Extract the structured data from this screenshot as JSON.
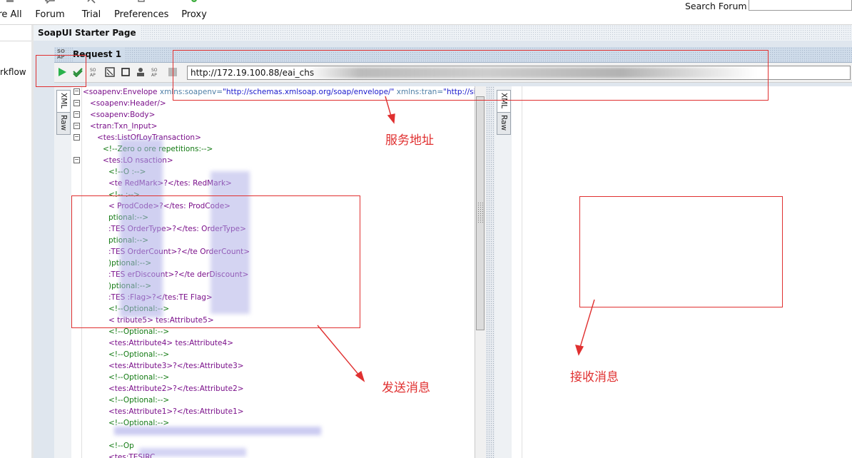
{
  "toolbar": {
    "items": [
      {
        "label": "re All",
        "icon": "save-all-icon"
      },
      {
        "label": "Forum",
        "icon": "forum-icon"
      },
      {
        "label": "Trial",
        "icon": "trial-icon"
      },
      {
        "label": "Preferences",
        "icon": "preferences-icon"
      },
      {
        "label": "Proxy",
        "icon": "proxy-icon"
      }
    ],
    "search_label": "Search Forum",
    "search_value": ""
  },
  "navigator": {
    "item_label": "rkflow"
  },
  "tabs": {
    "starter_page": "SoapUI Starter Page"
  },
  "request": {
    "title": "Request 1",
    "icon_text": "SO AP",
    "endpoint": "http://172.19.100.88/eai_chs",
    "editor_tabs": [
      "XML",
      "Raw"
    ],
    "response_tabs": [
      "XML",
      "Raw"
    ]
  },
  "xml_lines": [
    {
      "indent": 0,
      "tag": "<soapenv:Envelope",
      "attrs": " xmlns:soapenv=",
      "val1": "\"http://schemas.xmlsoap.org/soap/envelope/\"",
      "attrs2": " xmlns:tran=",
      "val2": "\"http://siebel.com/"
    },
    {
      "indent": 1,
      "tag": "<soapenv:Header/>"
    },
    {
      "indent": 1,
      "tag": "<soapenv:Body>"
    },
    {
      "indent": 2,
      "tag": "<tran:Txn_Input>"
    },
    {
      "indent": 3,
      "tag": "<tes:ListOfLoyTransaction>"
    },
    {
      "indent": 4,
      "comment": "<!--Zero o    ore repetitions:-->"
    },
    {
      "indent": 4,
      "tag": "<tes:LO        nsaction>"
    },
    {
      "indent": 5,
      "comment": "<!--O       :-->"
    },
    {
      "indent": 5,
      "tag": "<te         RedMark>?</tes:         RedMark>"
    },
    {
      "indent": 5,
      "comment": "<!--        :-->"
    },
    {
      "indent": 5,
      "tag": "<          ProdCode>?</tes:          ProdCode>"
    },
    {
      "indent": 5,
      "comment": "      ptional:-->"
    },
    {
      "indent": 5,
      "tag": "    :TES     OrderType>?</tes:          OrderType>"
    },
    {
      "indent": 5,
      "comment": "      ptional:-->"
    },
    {
      "indent": 5,
      "tag": "    :TES     OrderCount>?</te          OrderCount>"
    },
    {
      "indent": 5,
      "comment": "     )ptional:-->"
    },
    {
      "indent": 5,
      "tag": "    :TES     erDiscount>?</te          derDiscount>"
    },
    {
      "indent": 5,
      "comment": "     )ptional:-->"
    },
    {
      "indent": 5,
      "tag": "    :TES        :Flag>?</tes:TE          Flag>"
    },
    {
      "indent": 5,
      "comment": "<!--Optional:-->"
    },
    {
      "indent": 5,
      "tag": "<        tribute5>   tes:Attribute5>"
    },
    {
      "indent": 5,
      "comment": "<!--Optional:-->"
    },
    {
      "indent": 5,
      "tag": "<tes:Attribute4>   tes:Attribute4>"
    },
    {
      "indent": 5,
      "comment": "<!--Optional:-->"
    },
    {
      "indent": 5,
      "tag": "<tes:Attribute3>?</tes:Attribute3>"
    },
    {
      "indent": 5,
      "comment": "<!--Optional:-->"
    },
    {
      "indent": 5,
      "tag": "<tes:Attribute2>?</tes:Attribute2>"
    },
    {
      "indent": 5,
      "comment": "<!--Optional:-->"
    },
    {
      "indent": 5,
      "tag": "<tes:Attribute1>?</tes:Attribute1>"
    },
    {
      "indent": 5,
      "comment": "<!--Optional:-->"
    },
    {
      "indent": 5,
      "tag": ""
    },
    {
      "indent": 5,
      "comment": "<!--Op"
    },
    {
      "indent": 5,
      "tag": "<tes:TESIRC"
    }
  ],
  "annotations": {
    "service_address": "服务地址",
    "send_message": "发送消息",
    "receive_message": "接收消息"
  },
  "colors": {
    "annotation_red": "#e03030",
    "xml_tag": "#7a0f8a",
    "xml_attr": "#4f7fa6",
    "xml_value": "#1a1acc",
    "xml_comment": "#137a13",
    "run_green": "#2bb24c"
  }
}
